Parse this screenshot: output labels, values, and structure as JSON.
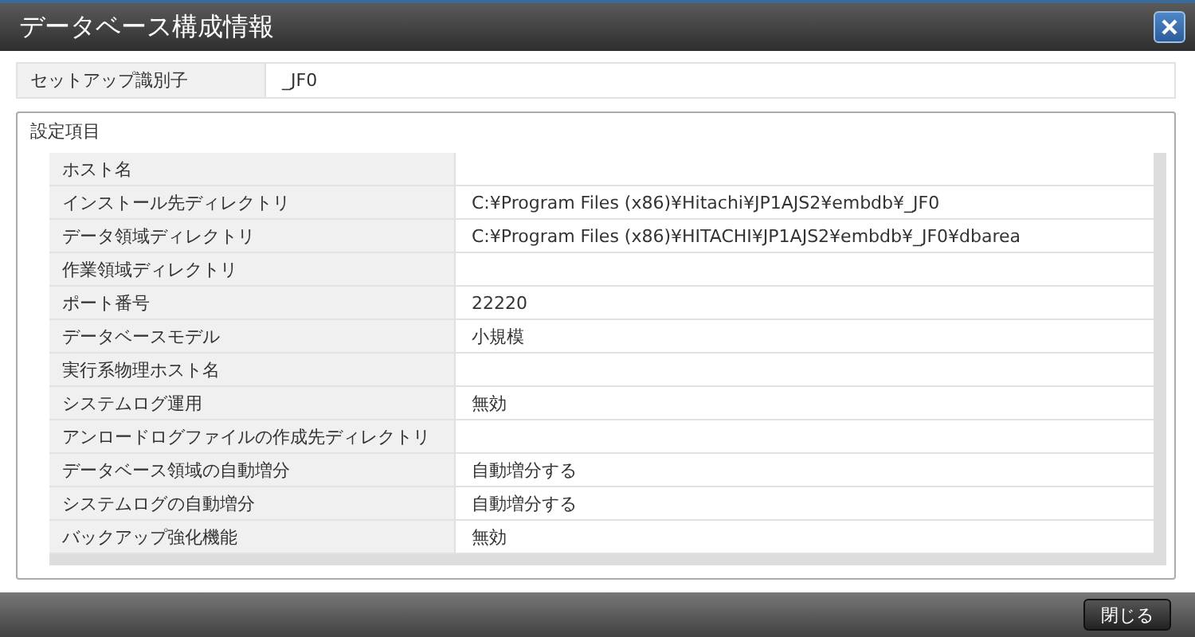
{
  "window": {
    "title": "データベース構成情報"
  },
  "setup": {
    "label": "セットアップ識別子",
    "value": "_JF0"
  },
  "settings": {
    "title": "設定項目",
    "rows": [
      {
        "label": "ホスト名"
      },
      {
        "label": "インストール先ディレクトリ",
        "value": "C:¥Program Files (x86)¥Hitachi¥JP1AJS2¥embdb¥_JF0"
      },
      {
        "label": "データ領域ディレクトリ",
        "value": "C:¥Program Files (x86)¥HITACHI¥JP1AJS2¥embdb¥_JF0¥dbarea"
      },
      {
        "label": "作業領域ディレクトリ"
      },
      {
        "label": "ポート番号",
        "value": "22220"
      },
      {
        "label": "データベースモデル",
        "value": "小規模"
      },
      {
        "label": "実行系物理ホスト名"
      },
      {
        "label": "システムログ運用",
        "value": "無効"
      },
      {
        "label": "アンロードログファイルの作成先ディレクトリ"
      },
      {
        "label": "データベース領域の自動増分",
        "value": "自動増分する"
      },
      {
        "label": "システムログの自動増分",
        "value": "自動増分する"
      },
      {
        "label": "バックアップ強化機能",
        "value": "無効"
      }
    ]
  },
  "buttons": [
    "閉じる"
  ]
}
